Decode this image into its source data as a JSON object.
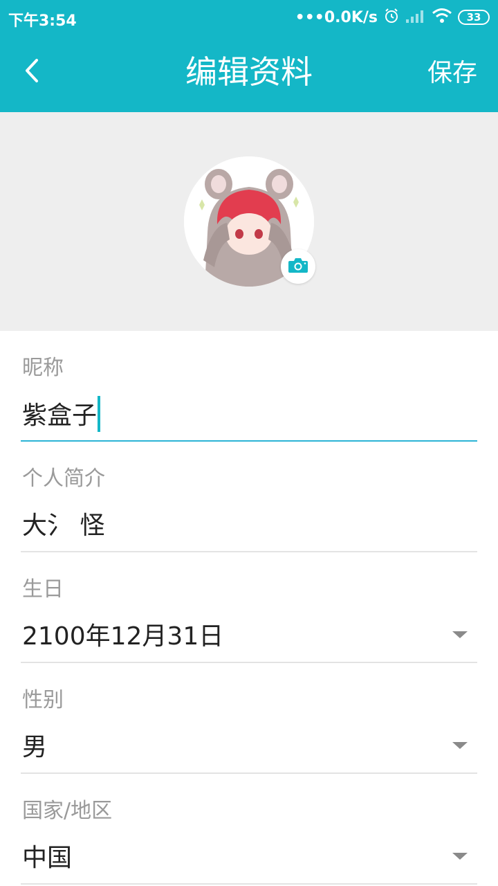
{
  "status_bar": {
    "time": "下午3:54",
    "net_speed": "•••0.0K/s",
    "battery": "33"
  },
  "header": {
    "title": "编辑资料",
    "save_label": "保存"
  },
  "profile": {
    "nickname_label": "昵称",
    "nickname_value": "紫盒子",
    "bio_label": "个人简介",
    "bio_value": "大氵 怪",
    "birthday_label": "生日",
    "birthday_value": "2100年12月31日",
    "gender_label": "性别",
    "gender_value": "男",
    "region_label": "国家/地区",
    "region_value": "中国"
  },
  "colors": {
    "accent": "#14b7c7",
    "underline_active": "#2bb3d6",
    "avatar_bg": "#eeeeee"
  }
}
